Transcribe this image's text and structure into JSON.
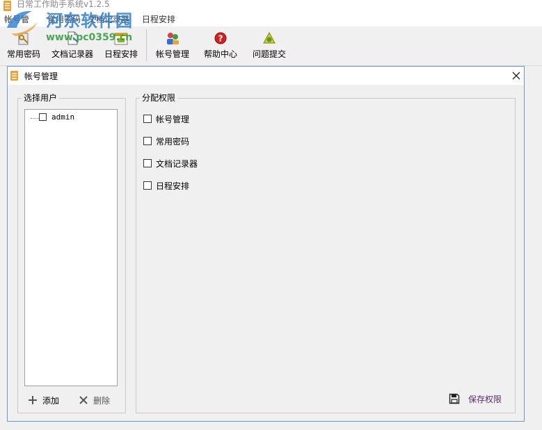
{
  "app": {
    "title": "日常工作助手系统v1.2.5"
  },
  "menu": {
    "items": [
      "帐号管",
      "常用密码",
      "文档记录器",
      "日程安排"
    ]
  },
  "toolbar": {
    "buttons": [
      {
        "label": "常用密码",
        "icon": "key-icon"
      },
      {
        "label": "文档记录器",
        "icon": "document-icon"
      },
      {
        "label": "日程安排",
        "icon": "calendar-icon"
      },
      {
        "label": "帐号管理",
        "icon": "users-icon"
      },
      {
        "label": "帮助中心",
        "icon": "help-icon"
      },
      {
        "label": "问题提交",
        "icon": "submit-icon"
      }
    ]
  },
  "watermark": {
    "text": "河东软件园",
    "url": "www.pc0359.cn"
  },
  "dialog": {
    "title": "帐号管理",
    "user_group": {
      "label": "选择用户",
      "users": [
        {
          "name": "admin",
          "checked": false
        }
      ],
      "add_label": "添加",
      "delete_label": "删除"
    },
    "perm_group": {
      "label": "分配权限",
      "permissions": [
        {
          "label": "帐号管理",
          "checked": false
        },
        {
          "label": "常用密码",
          "checked": false
        },
        {
          "label": "文档记录器",
          "checked": false
        },
        {
          "label": "日程安排",
          "checked": false
        }
      ],
      "save_label": "保存权限"
    }
  },
  "colors": {
    "accent": "#6a96c8",
    "app_icon": "#f0a030",
    "help": "#d42020",
    "save_text": "#5a2a6a"
  }
}
